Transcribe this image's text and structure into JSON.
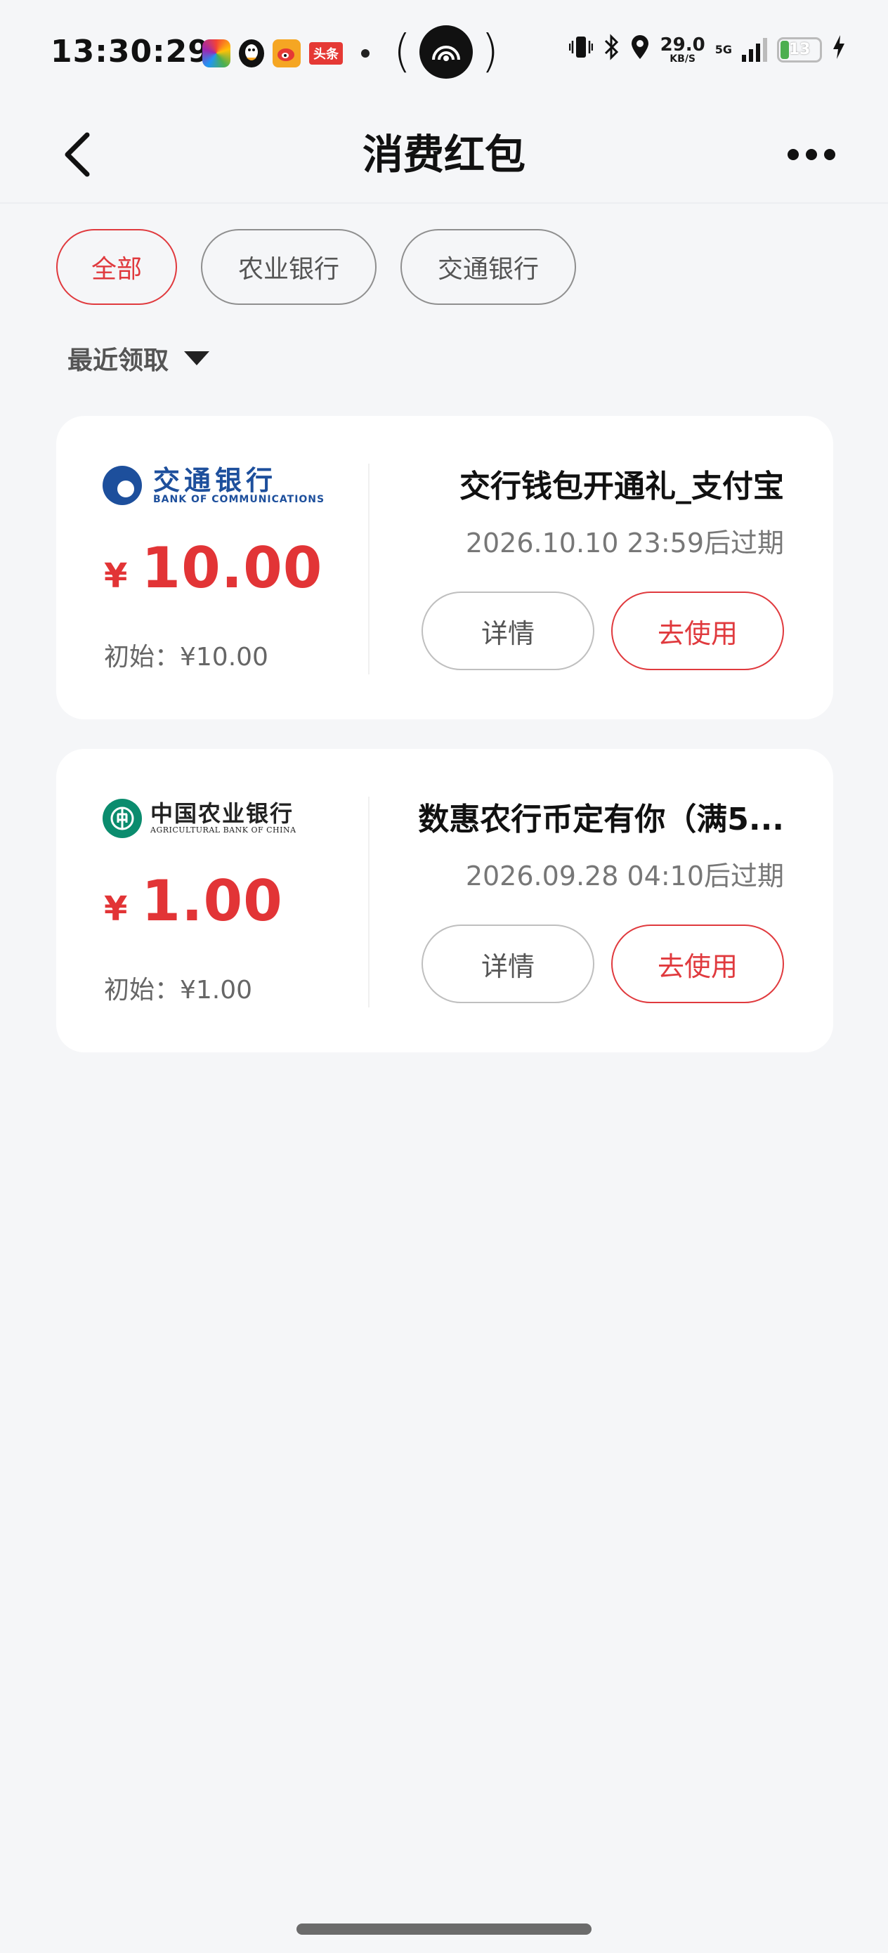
{
  "status_bar": {
    "time": "13:30:29",
    "notification_apps": [
      "photos-icon",
      "qq-icon",
      "weibo-icon",
      "toutiao-icon"
    ],
    "toutiao_label": "头条",
    "net_speed_value": "29.0",
    "net_speed_unit": "KB/S",
    "network_type": "5G",
    "battery_level": "13",
    "icons": [
      "vibrate-icon",
      "bluetooth-icon",
      "location-icon",
      "signal-icon",
      "battery-icon",
      "charging-icon"
    ]
  },
  "nav": {
    "title": "消费红包",
    "back_icon": "chevron-left-icon",
    "more_icon": "more-icon"
  },
  "filters": {
    "chips": [
      "全部",
      "农业银行",
      "交通银行"
    ],
    "active_index": 0
  },
  "sort": {
    "label": "最近领取"
  },
  "coupons": [
    {
      "bank_logo_cn": "交通银行",
      "bank_logo_en": "BANK OF COMMUNICATIONS",
      "currency": "¥",
      "amount": "10.00",
      "initial": "初始：¥10.00",
      "title": "交行钱包开通礼_支付宝",
      "expire": "2026.10.10 23:59后过期",
      "detail_label": "详情",
      "use_label": "去使用"
    },
    {
      "bank_logo_cn": "中国农业银行",
      "bank_logo_en": "AGRICULTURAL BANK OF CHINA",
      "currency": "¥",
      "amount": "1.00",
      "initial": "初始：¥1.00",
      "title": "数惠农行币定有你（满5...",
      "expire": "2026.09.28 04:10后过期",
      "detail_label": "详情",
      "use_label": "去使用"
    }
  ],
  "colors": {
    "accent_red": "#e03a3e",
    "page_bg": "#f5f6f8",
    "boc_blue": "#1d4f9c",
    "abc_green": "#0b8c6e"
  }
}
